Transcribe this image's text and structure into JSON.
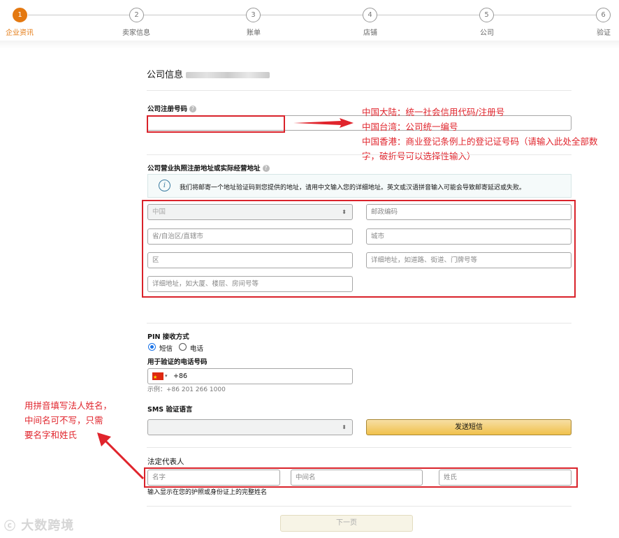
{
  "stepper": {
    "steps": [
      {
        "number": "1",
        "label": "企业资讯",
        "active": true
      },
      {
        "number": "2",
        "label": "卖家信息",
        "active": false
      },
      {
        "number": "3",
        "label": "账单",
        "active": false
      },
      {
        "number": "4",
        "label": "店铺",
        "active": false
      },
      {
        "number": "5",
        "label": "公司",
        "active": false
      },
      {
        "number": "6",
        "label": "验证",
        "active": false
      }
    ],
    "accent_color": "#e47911"
  },
  "page_title": "公司信息",
  "registration": {
    "label": "公司注册号码",
    "value": ""
  },
  "annotation_registration": {
    "lines": [
      "中国大陆：统一社会信用代码/注册号",
      "中国台湾：公司统一编号",
      "中国香港：商业登记条例上的登记证号码（请输入此处全部数",
      "字，破折号可以选择性输入）"
    ]
  },
  "address": {
    "label": "公司营业执照注册地址或实际经营地址",
    "info_text": "我们将邮寄一个地址验证码到您提供的地址，请用中文输入您的详细地址。英文或汉语拼音输入可能会导致邮寄延迟或失败。",
    "country": "中国",
    "postal_placeholder": "邮政编码",
    "province_placeholder": "省/自治区/直辖市",
    "city_placeholder": "城市",
    "district_placeholder": "区",
    "street_placeholder": "详细地址，如道路、街道、门牌号等",
    "detail_placeholder": "详细地址，如大厦、楼层、房间号等"
  },
  "pin": {
    "label": "PIN 接收方式",
    "options": [
      {
        "label": "短信",
        "selected": true
      },
      {
        "label": "电话",
        "selected": false
      }
    ],
    "phone_label": "用于验证的电话号码",
    "country_code": "+86",
    "example": "示例：+86 201 266 1000"
  },
  "sms": {
    "label": "SMS 验证语言",
    "language_value": "",
    "send_button": "发送短信"
  },
  "legal_rep": {
    "label": "法定代表人",
    "first_name_placeholder": "名字",
    "middle_name_placeholder": "中间名",
    "last_name_placeholder": "姓氏",
    "hint": "输入显示在您的护照或身份证上的完整姓名"
  },
  "annotation_legal": {
    "lines": [
      "用拼音填写法人姓名，",
      "中间名可不写，只需",
      "要名字和姓氏"
    ]
  },
  "next_button": "下一页",
  "watermark": "大数跨境",
  "colors": {
    "annotation_red": "#d9222a",
    "button_yellow": "#f0c14b",
    "radio_blue": "#1a73e8"
  }
}
